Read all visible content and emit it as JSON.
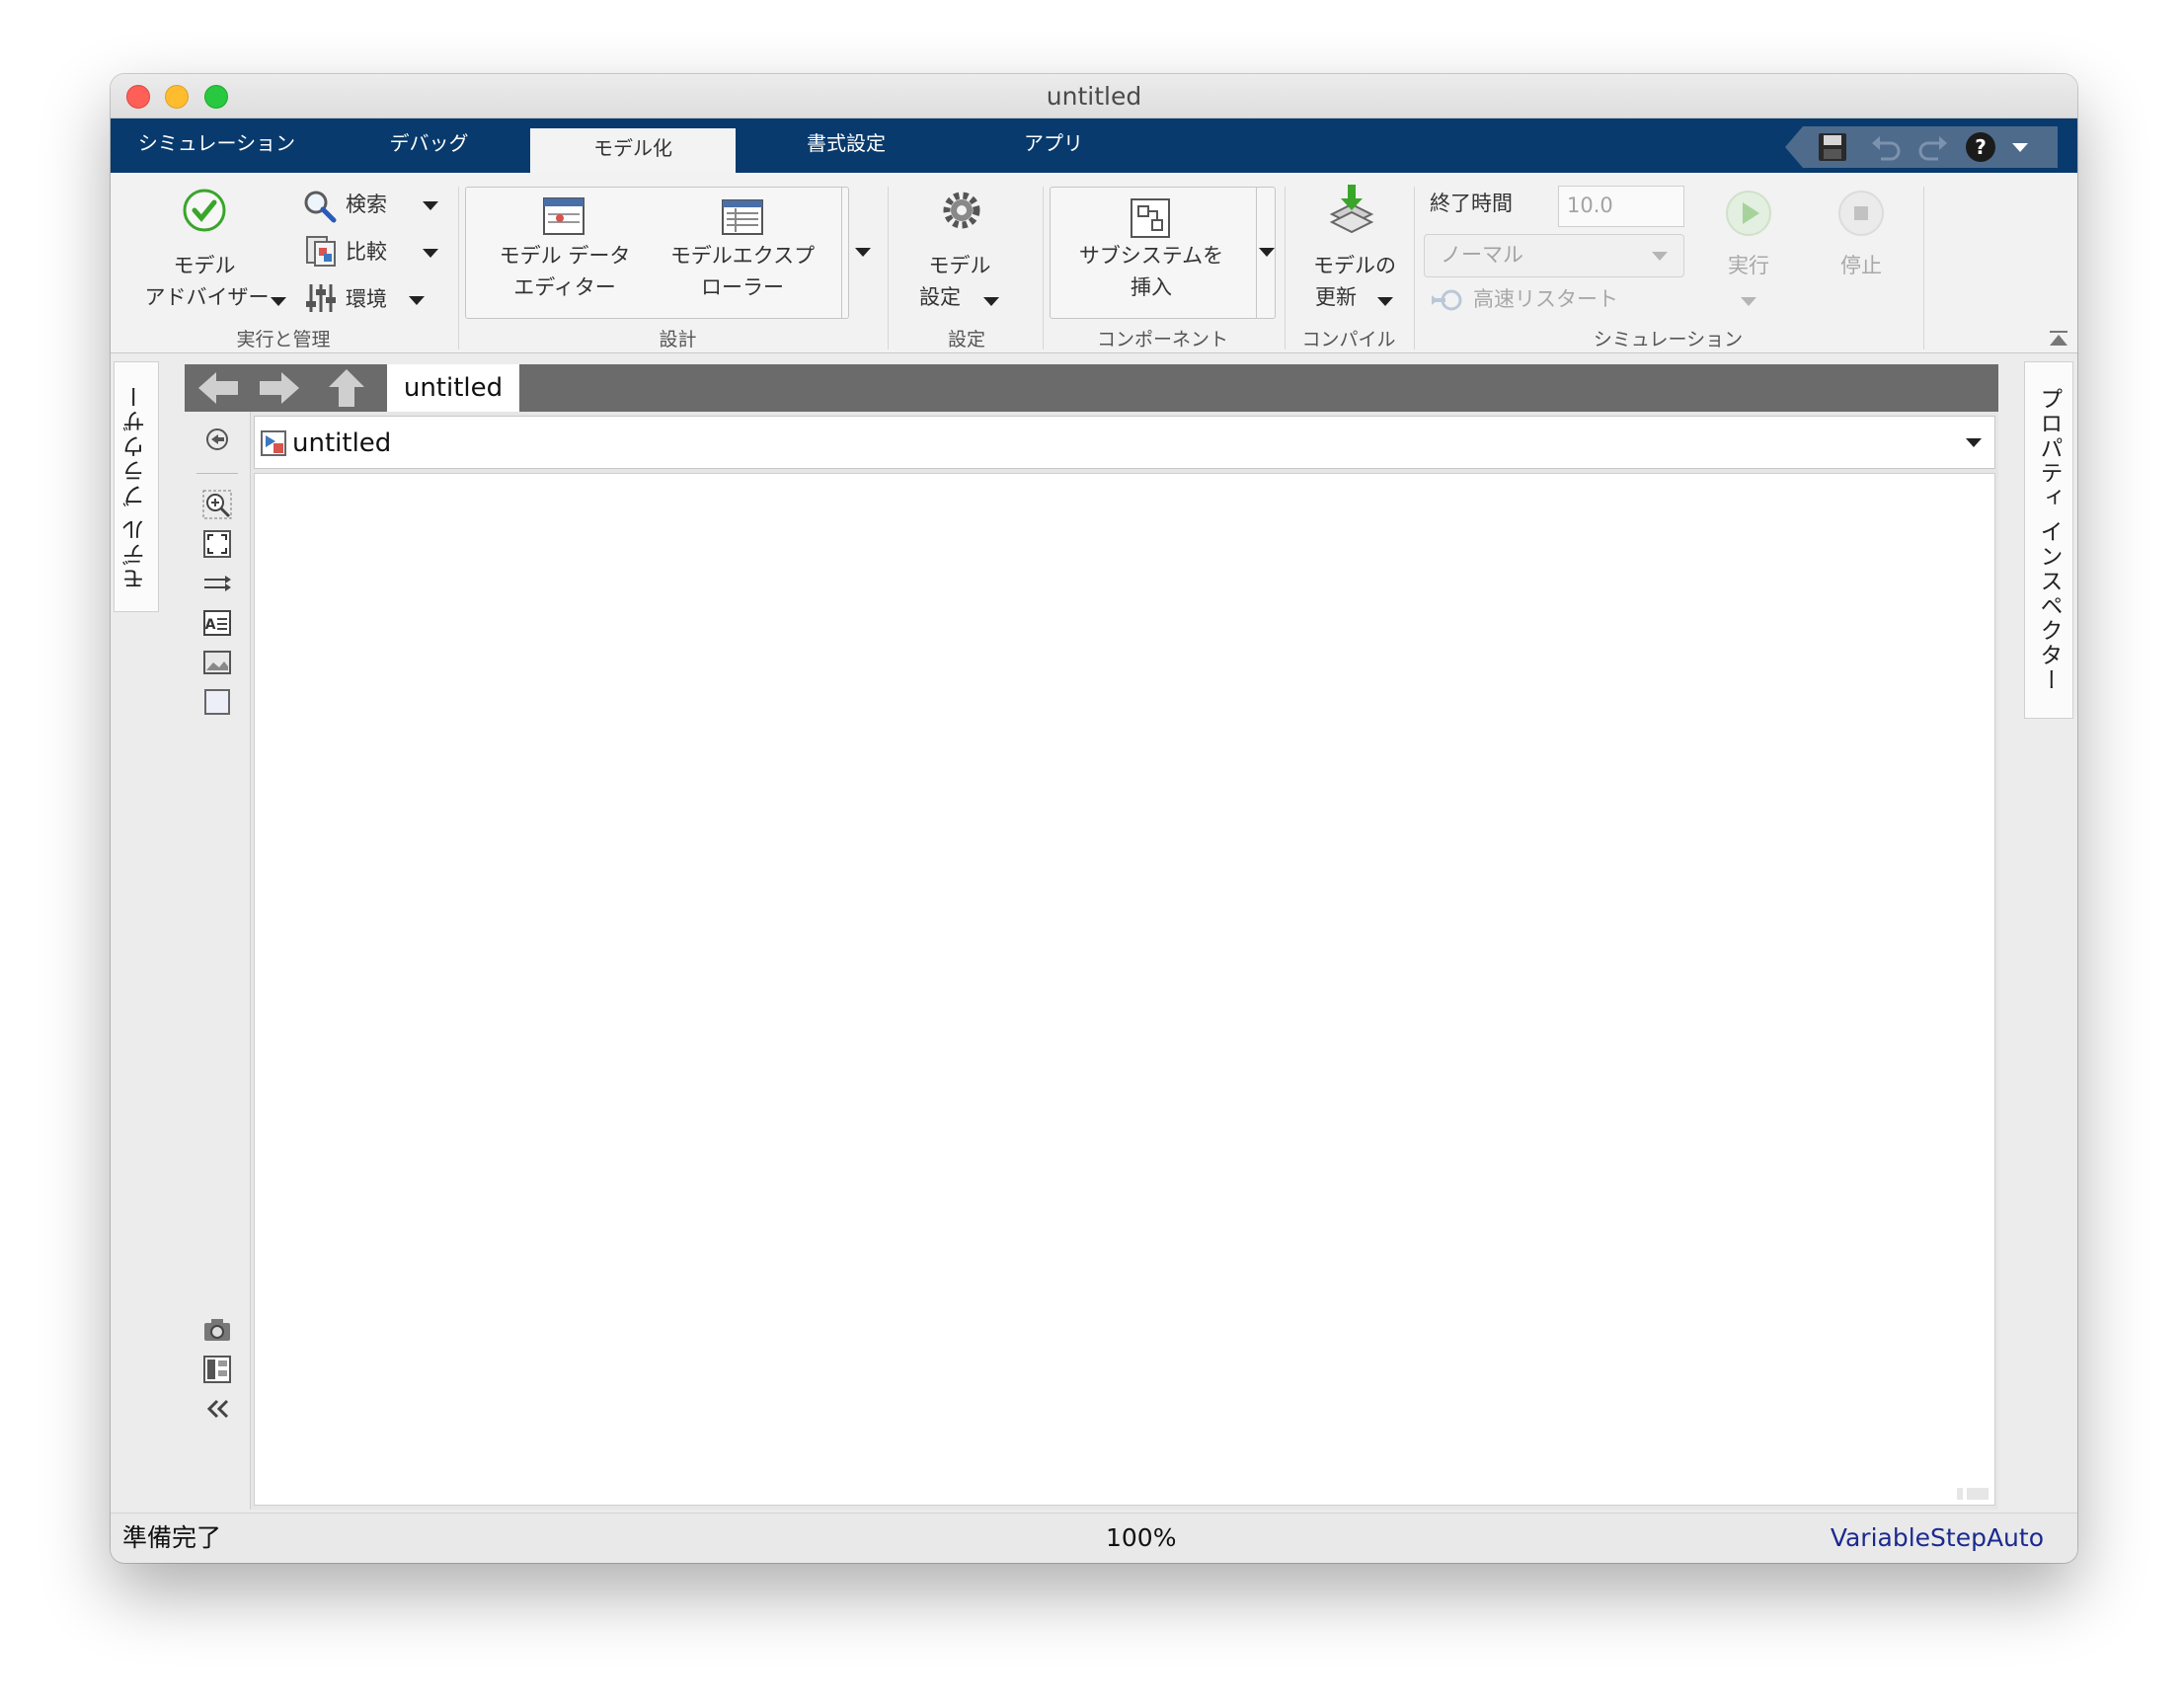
{
  "window": {
    "title": "untitled"
  },
  "tabs": [
    "シミュレーション",
    "デバッグ",
    "モデル化",
    "書式設定",
    "アプリ"
  ],
  "active_tab": "モデル化",
  "ribbon": {
    "advisor": {
      "line1": "モデル",
      "line2": "アドバイザー"
    },
    "search": "検索",
    "compare": "比較",
    "environment": "環境",
    "group_run_manage": "実行と管理",
    "data_editor": {
      "line1": "モデル データ",
      "line2": "エディター"
    },
    "explorer": {
      "line1": "モデルエクスプ",
      "line2": "ローラー"
    },
    "group_design": "設計",
    "model_settings": {
      "line1": "モデル",
      "line2": "設定"
    },
    "group_settings": "設定",
    "insert_subsystem": {
      "line1": "サブシステムを",
      "line2": "挿入"
    },
    "group_component": "コンポーネント",
    "update_model": {
      "line1": "モデルの",
      "line2": "更新"
    },
    "group_compile": "コンパイル",
    "stop_time_label": "終了時間",
    "stop_time_value": "10.0",
    "sim_mode": "ノーマル",
    "fast_restart": "高速リスタート",
    "run": "実行",
    "stop": "停止",
    "group_simulation": "シミュレーション"
  },
  "side": {
    "model_browser": "モデル ブラウザー",
    "property_inspector": "プロパティ インスペクター"
  },
  "editor": {
    "tab_name": "untitled",
    "address": "untitled"
  },
  "status": {
    "left": "準備完了",
    "zoom": "100%",
    "solver": "VariableStepAuto",
    "solver_color": "#1b2a8f"
  },
  "colors": {
    "tabbar": "#083a6d",
    "accent_green": "#3aa52b"
  }
}
